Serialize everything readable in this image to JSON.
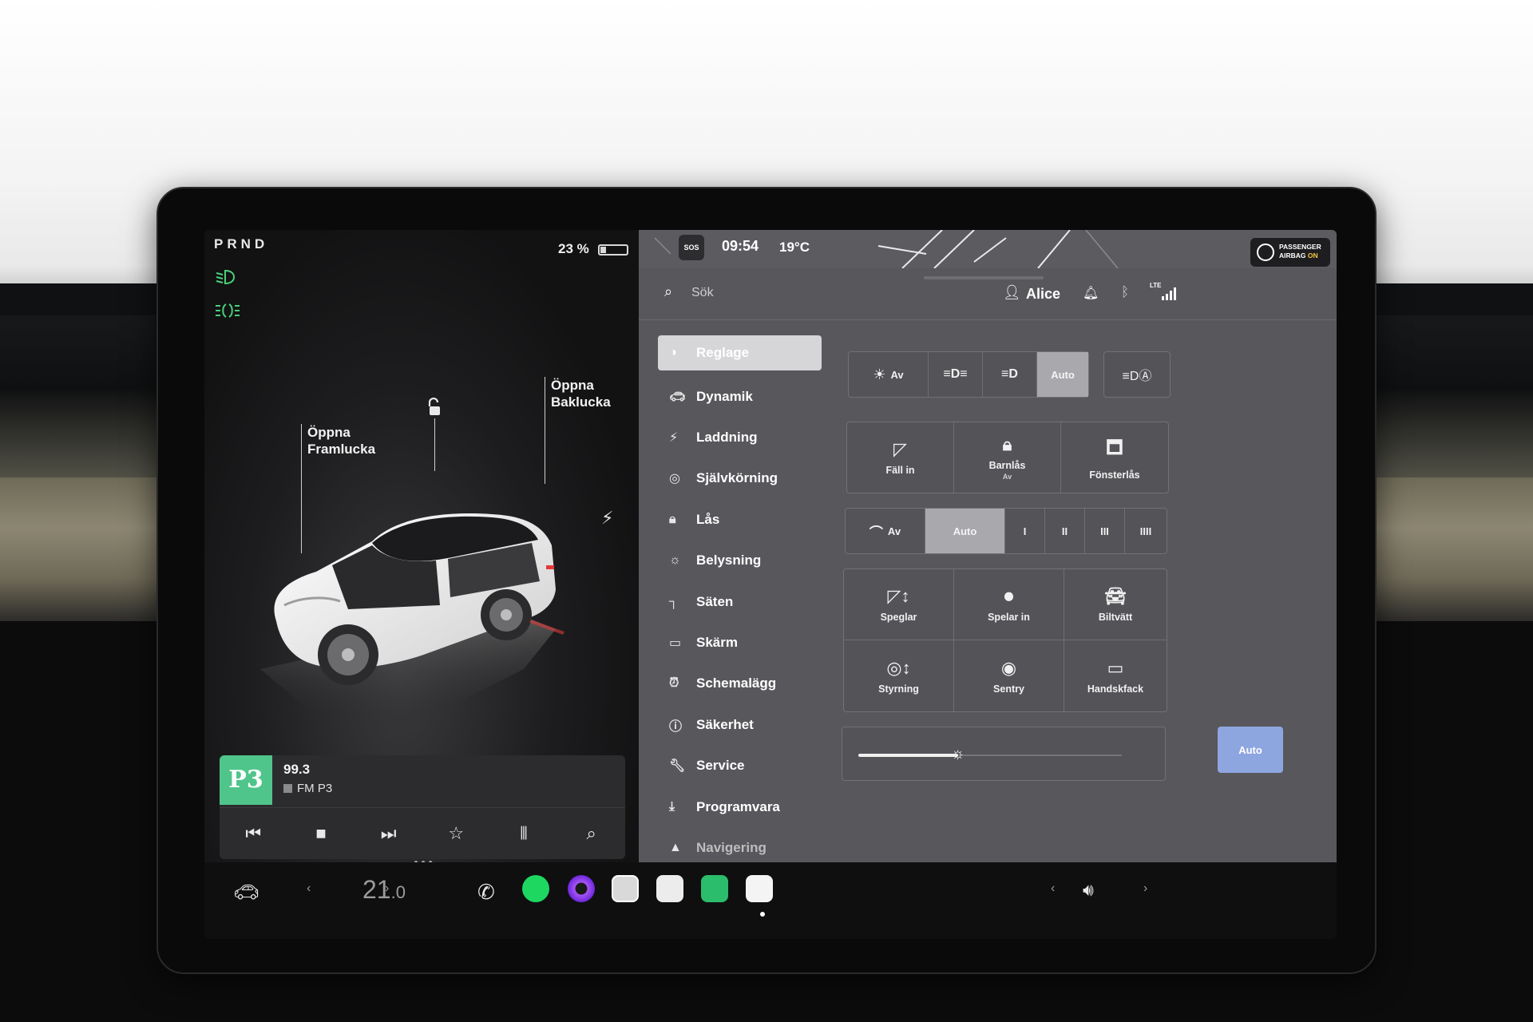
{
  "status": {
    "gear": "PRND",
    "battery_percent": "23 %",
    "time": "09:54",
    "temperature": "19°C",
    "airbag_line1": "PASSENGER",
    "airbag_line2_prefix": "AIRBAG",
    "airbag_line2_state": "ON",
    "sos": "SOS",
    "lte": "LTE"
  },
  "car_view": {
    "frunk_line1": "Öppna",
    "frunk_line2": "Framlucka",
    "trunk_line1": "Öppna",
    "trunk_line2": "Baklucka"
  },
  "media": {
    "station_logo": "P3",
    "frequency": "99.3",
    "station": "FM P3"
  },
  "header": {
    "search_placeholder": "Sök",
    "user_name": "Alice"
  },
  "menu": {
    "items": [
      {
        "label": "Reglage",
        "icon": "toggle-icon"
      },
      {
        "label": "Dynamik",
        "icon": "car-icon"
      },
      {
        "label": "Laddning",
        "icon": "bolt-icon"
      },
      {
        "label": "Självkörning",
        "icon": "steering-wheel-icon"
      },
      {
        "label": "Lås",
        "icon": "lock-icon"
      },
      {
        "label": "Belysning",
        "icon": "sun-icon"
      },
      {
        "label": "Säten",
        "icon": "seat-icon"
      },
      {
        "label": "Skärm",
        "icon": "display-icon"
      },
      {
        "label": "Schemalägg",
        "icon": "clock-icon"
      },
      {
        "label": "Säkerhet",
        "icon": "info-icon"
      },
      {
        "label": "Service",
        "icon": "wrench-icon"
      },
      {
        "label": "Programvara",
        "icon": "download-icon"
      },
      {
        "label": "Navigering",
        "icon": "navigation-icon"
      }
    ]
  },
  "controls": {
    "lights_off": "Av",
    "lights_auto": "Auto",
    "fold_mirrors": "Fäll in",
    "child_lock": "Barnlås",
    "child_lock_state": "Av",
    "window_lock": "Fönsterlås",
    "wipers_off": "Av",
    "wipers_auto": "Auto",
    "wiper_speeds": [
      "I",
      "II",
      "III",
      "IIII"
    ],
    "mirrors": "Speglar",
    "save_mirrors": "Spelar in",
    "car_wash": "Biltvätt",
    "steering": "Styrning",
    "sentry": "Sentry",
    "glovebox": "Handskfack",
    "brightness_auto": "Auto",
    "brightness_level": 0.38
  },
  "dock": {
    "temp_main": "21",
    "temp_decimal": ".0"
  },
  "colors": {
    "headlight_green": "#49d17a",
    "auto_blue": "#8ea6df",
    "p3_green": "#4fc58b",
    "right_pane_bg": "#58575c"
  }
}
